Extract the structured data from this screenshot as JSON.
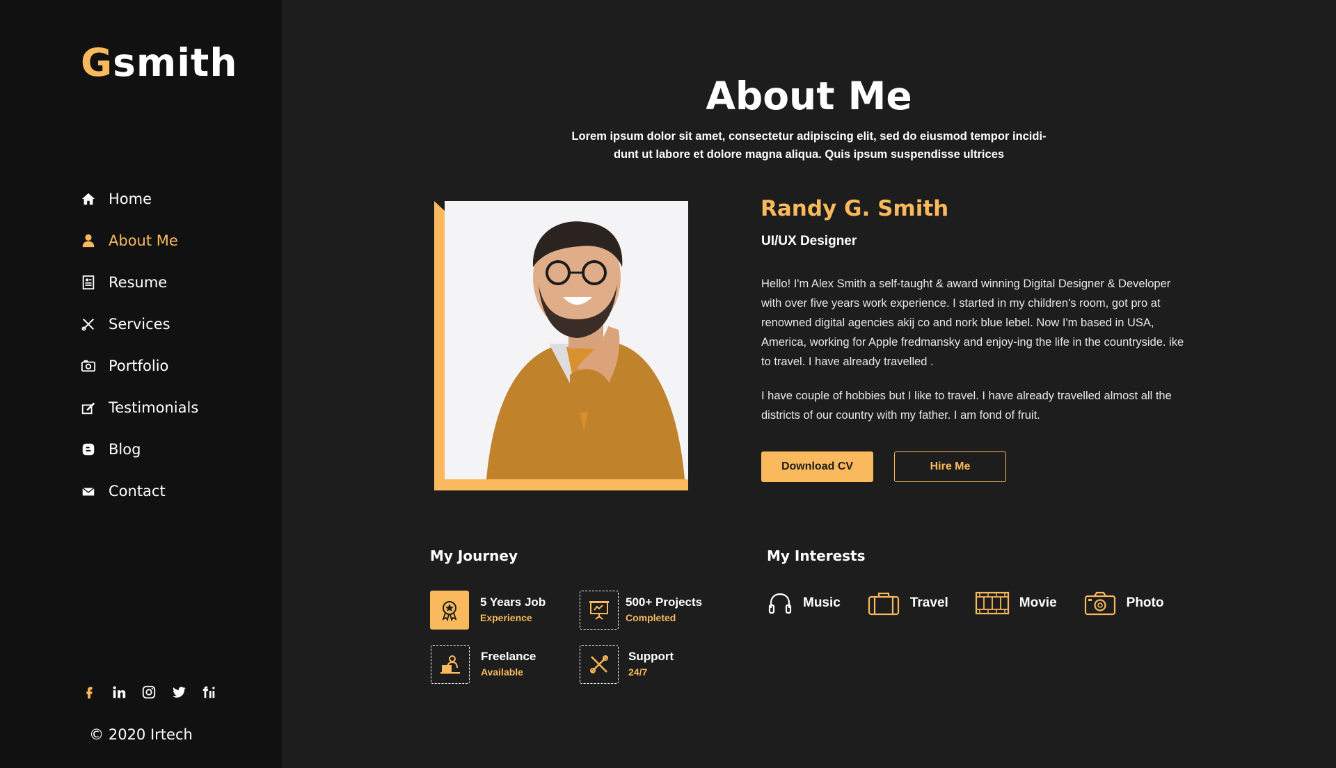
{
  "brand": {
    "first_letter": "G",
    "rest": "smith",
    "accent": "#f9b95c"
  },
  "nav": [
    {
      "label": "Home",
      "icon": "home-icon",
      "active": false
    },
    {
      "label": "About Me",
      "icon": "user-icon",
      "active": true
    },
    {
      "label": "Resume",
      "icon": "resume-icon",
      "active": false
    },
    {
      "label": "Services",
      "icon": "tools-icon",
      "active": false
    },
    {
      "label": "Portfolio",
      "icon": "portfolio-icon",
      "active": false
    },
    {
      "label": "Testimonials",
      "icon": "testimonial-icon",
      "active": false
    },
    {
      "label": "Blog",
      "icon": "blog-icon",
      "active": false
    },
    {
      "label": "Contact",
      "icon": "envelope-icon",
      "active": false
    }
  ],
  "social": [
    "facebook-icon",
    "linkedin-icon",
    "instagram-icon",
    "twitter-icon",
    "fiverr-icon"
  ],
  "copyright": "© 2020 Irtech",
  "page": {
    "title": "About Me",
    "intro_line1": "Lorem ipsum dolor sit amet, consectetur adipiscing elit, sed do eiusmod tempor incidi-",
    "intro_line2": "dunt ut labore et dolore magna aliqua. Quis ipsum suspendisse ultrices"
  },
  "profile": {
    "name": "Randy G. Smith",
    "role": "UI/UX Designer",
    "bio1": "Hello! I'm Alex Smith a self-taught & award winning Digital Designer & Developer with over five years work experience. I started in my children's room, got pro at renowned digital agencies akij co and nork blue lebel. Now I'm based in USA, America, working for Apple fredmansky and enjoy-ing the life in the countryside. ike to travel. I have already travelled .",
    "bio2": "I have couple of hobbies but I like to travel. I have already travelled almost all the districts of our country with my father. I am fond of fruit.",
    "download_label": "Download CV",
    "hire_label": "Hire Me"
  },
  "journey": {
    "heading": "My Journey",
    "items": [
      {
        "title": "5 Years Job",
        "sub": "Experience",
        "icon": "award-icon"
      },
      {
        "title": "500+ Projects",
        "sub": "Completed",
        "icon": "presentation-icon"
      },
      {
        "title": "Freelance",
        "sub": "Available",
        "icon": "freelancer-icon"
      },
      {
        "title": "Support",
        "sub": "24/7",
        "icon": "support-tools-icon"
      }
    ]
  },
  "interests": {
    "heading": "My Interests",
    "items": [
      {
        "label": "Music",
        "icon": "headphones-icon"
      },
      {
        "label": "Travel",
        "icon": "suitcase-icon"
      },
      {
        "label": "Movie",
        "icon": "film-icon"
      },
      {
        "label": "Photo",
        "icon": "camera-icon"
      }
    ]
  }
}
